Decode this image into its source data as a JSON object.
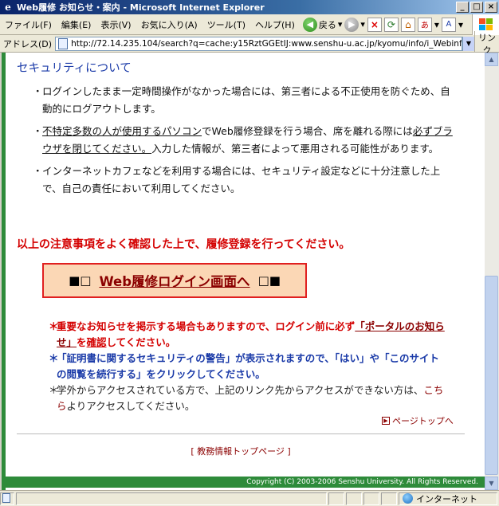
{
  "window": {
    "title": "Web履修 お知らせ・案内 - Microsoft Internet Explorer",
    "minimize": "_",
    "maximize": "□",
    "close": "×"
  },
  "menu": {
    "items": [
      {
        "label": "ファイル(F)"
      },
      {
        "label": "編集(E)"
      },
      {
        "label": "表示(V)"
      },
      {
        "label": "お気に入り(A)"
      },
      {
        "label": "ツール(T)"
      },
      {
        "label": "ヘルプ(H)"
      }
    ]
  },
  "toolbar": {
    "back_label": "戻る",
    "back_arrow": "◀",
    "forward_arrow": "▶",
    "stop_glyph": "×",
    "refresh_glyph": "⟳",
    "home_glyph": "⌂",
    "dropdown": "▾"
  },
  "address": {
    "label": "アドレス(D)",
    "url": "http://72.14.235.104/search?q=cache:y15RztGGEtIJ:www.senshu-u.ac.jp/kyomu/info/i_Webinfo.htm+%E7%99%",
    "links_label": "リンク"
  },
  "content": {
    "section_heading": "セキュリティについて",
    "bullets": {
      "b1": "ログインしたまま一定時間操作がなかった場合には、第三者による不正使用を防ぐため、自動的にログアウトします。",
      "b2_a": "不特定多数の人が",
      "b2_b": "使用する",
      "b2_c": "パソコン",
      "b2_d": "でWeb履修登録を行う場合、席を離れる際には",
      "b2_e": "必ずブラウザを閉じてください。",
      "b2_f": "入力した情報が、第三者によって悪用される可能性があります。",
      "b3": "インターネットカフェなどを利用する場合には、セキュリティ設定などに十分注意した上で、自己の責任において利用してください。"
    },
    "notice": "以上の注意事項をよく確認した上で、履修登録を行ってください。",
    "login": {
      "left_symbols": "■□",
      "label": "Web履修ログイン画面へ",
      "right_symbols": "□■"
    },
    "notes": {
      "mark": "＊",
      "red_a": "重要なお知らせを掲示する場合もありますので、ログイン前に必ず",
      "red_link": "「ポータルのお知らせ」",
      "red_b": "を",
      "red_c": "確認",
      "red_d": "してください。",
      "blue": "「証明書に関するセキュリティの警告」が表示されますので、「はい」や「このサイトの閲覧を続行する」をクリックしてください。",
      "black_a": "学外からアクセスされている方で、上記のリンク先からアクセスができない方は、",
      "black_link": "こちら",
      "black_b": "よりアクセスしてください。"
    },
    "page_top": "ページトップへ",
    "page_top_icon": "▶",
    "footer_link": "[ 教務情報トップページ ]",
    "copyright": "Copyright (C) 2003-2006 Senshu University. All Rights Reserved."
  },
  "status": {
    "zone": "インターネット"
  }
}
